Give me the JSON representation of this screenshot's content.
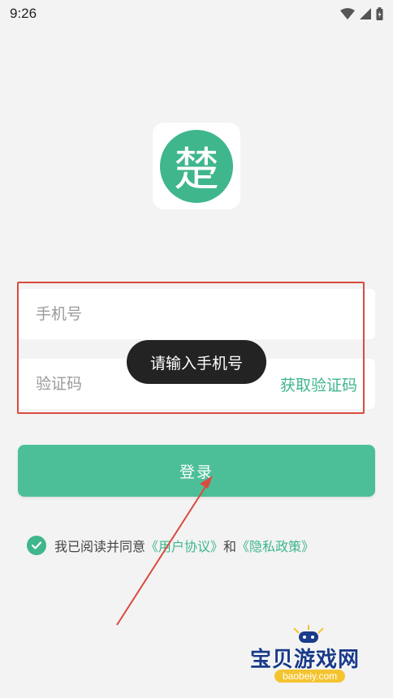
{
  "status_bar": {
    "time": "9:26"
  },
  "logo": {
    "glyph": "楚"
  },
  "form": {
    "phone_placeholder": "手机号",
    "code_placeholder": "验证码",
    "get_code_label": "获取验证码"
  },
  "toast": {
    "message": "请输入手机号"
  },
  "login": {
    "label": "登录"
  },
  "agreement": {
    "prefix": "我已阅读并同意",
    "user_agreement": "《用户协议》",
    "conjunction": "和",
    "privacy_policy": "《隐私政策》"
  },
  "watermark": {
    "title": "宝贝游戏网",
    "url": "baobeiy.com"
  },
  "colors": {
    "accent": "#3fb68c",
    "button": "#4dbf98",
    "annotation_red": "#d94b3f",
    "toast_bg": "#232323"
  }
}
